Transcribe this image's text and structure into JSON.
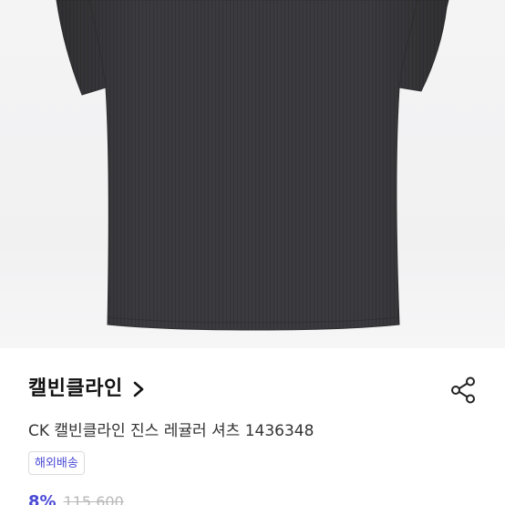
{
  "product": {
    "image_alt": "black short-sleeve ribbed cropped tee",
    "brand": "캘빈클라인",
    "title": "CK 캘빈클라인 진스 레귤러 셔츠 1436348",
    "shipping_badge": "해외배송",
    "discount": "8%",
    "original_price": "115,600"
  },
  "icons": {
    "brand_link": "chevron-right-icon",
    "share": "share-icon"
  },
  "colors": {
    "accent": "#4a4ad6",
    "garment": "#3a393c",
    "text_primary": "#111111"
  }
}
